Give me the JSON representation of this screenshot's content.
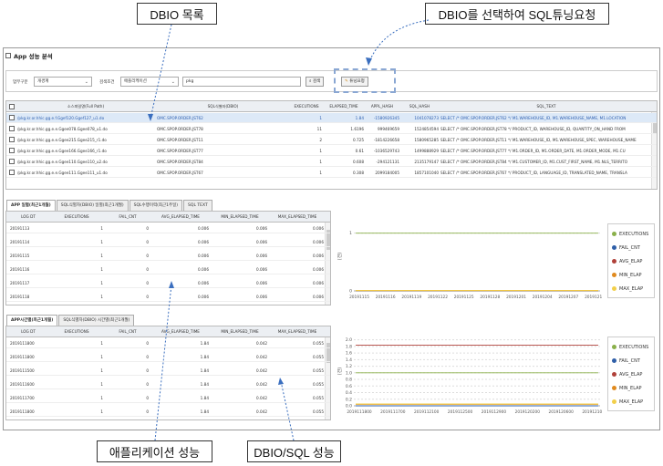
{
  "callouts": {
    "dbio_list": "DBIO 목록",
    "select_sql_tuning": "DBIO를 선택하여 SQL튜닝요청",
    "app_perf": "애플리케이션 성능",
    "dbio_sql_perf": "DBIO/SQL 성능"
  },
  "app": {
    "title": "App 성능 분석"
  },
  "search": {
    "task_label": "업무구분",
    "task_value": "개경계",
    "cond_label": "검색조건",
    "cond_value": "애플리케이션",
    "keyword": "pkg",
    "search_btn": "검색",
    "tuning_btn": "튜닝요청"
  },
  "dbio_grid": {
    "headers": [
      "소스파일명(Full Path)",
      "SQL식별자(DBIO)",
      "EXECUTIONS",
      "ELAPSED_TIME",
      "APPL_HASH",
      "SQL_HASH",
      "SQL_TEXT"
    ],
    "rows": [
      {
        "path": "/pkg.kr.or.hhic.gg.e.f.Ggef120.Ggef127_u1.do",
        "dbio": "OMC.SPOP.ORDER.JST62",
        "exec": "1",
        "elapsed": "1.84",
        "appl_hash": "-1580926345",
        "sql_hash": "1041078273",
        "sql_text": "SELECT /* OMC.SPOP.ORDER.JST62 */ M1.WAREHOUSE_ID, M1.WAREHOUSE_NAME, M1.LOCATION"
      },
      {
        "path": "/pkg.kr.or.hhic.gg.e.e.Ggee078.Ggee078_u1.do",
        "dbio": "OMC.SPOP.ORDER.JST78",
        "exec": "11",
        "elapsed": "1.6196",
        "appl_hash": "999469659",
        "sql_hash": "1524854594",
        "sql_text": "SELECT /* OMC.SPOP.ORDER.JST78 */ PRODUCT_ID, WAREHOUSE_ID, QUANTITY_ON_HAND FROM"
      },
      {
        "path": "/pkg.kr.or.hhic.gg.e.e.Ggee215.Ggee215_r1.do",
        "dbio": "OMC.SPOP.ORDER.JST11",
        "exec": "2",
        "elapsed": "0.725",
        "appl_hash": "-1814226658",
        "sql_hash": "1580965285",
        "sql_text": "SELECT /* OMC.SPOP.ORDER.JST11 */ M1.WAREHOUSE_ID, M1.WAREHOUSE_SPEC, WAREHOUSE_NAME"
      },
      {
        "path": "/pkg.kr.or.hhic.gg.e.e.Ggee166.Ggee166_r1.do",
        "dbio": "OMC.SPOP.ORDER.JST77",
        "exec": "1",
        "elapsed": "0.61",
        "appl_hash": "-1036529743",
        "sql_hash": "1499888929",
        "sql_text": "SELECT /* OMC.SPOP.ORDER.JST77 */ M1.ORDER_ID, M1.ORDER_DATE, M1.ORDER_MODE, M1.CU"
      },
      {
        "path": "/pkg.kr.or.hhic.gg.e.e.Ggee110.Ggee110_u2.do",
        "dbio": "OMC.SPOP.ORDER.JST84",
        "exec": "1",
        "elapsed": "0.608",
        "appl_hash": "-294121131",
        "sql_hash": "2135179147",
        "sql_text": "SELECT /* OMC.SPOP.ORDER.JST84 */ M1.CUSTOMER_ID, M1.CUST_FIRST_NAME, M1.NLS_TERRITO"
      },
      {
        "path": "/pkg.kr.or.hhic.gg.e.e.Ggee111.Ggee111_u1.do",
        "dbio": "OMC.SPOP.ORDER.JST67",
        "exec": "1",
        "elapsed": "0.308",
        "appl_hash": "2099184005",
        "sql_hash": "1857101040",
        "sql_text": "SELECT /* OMC.SPOP.ORDER.JST67 */ PRODUCT_ID, LANGUAGE_ID, TRANSLATED_NAME, TRANSLA"
      }
    ]
  },
  "tabs1": [
    "APP 일별(최근1개월)",
    "SQL식별자(DBIO) 일별(최근1개월)",
    "SQL수행이력(최근1주일)",
    "SQL TEXT"
  ],
  "daily_grid": {
    "headers": [
      "LOG DT",
      "EXECUTIONS",
      "FAIL_CNT",
      "AVG_ELAPSED_TIME",
      "MIN_ELAPSED_TIME",
      "MAX_ELAPSED_TIME"
    ],
    "rows": [
      [
        "20191113",
        "1",
        "0",
        "0.006",
        "0.006",
        "0.006"
      ],
      [
        "20191114",
        "1",
        "0",
        "0.006",
        "0.006",
        "0.006"
      ],
      [
        "20191115",
        "1",
        "0",
        "0.006",
        "0.006",
        "0.006"
      ],
      [
        "20191116",
        "1",
        "0",
        "0.006",
        "0.006",
        "0.006"
      ],
      [
        "20191117",
        "1",
        "0",
        "0.006",
        "0.006",
        "0.006"
      ],
      [
        "20191118",
        "1",
        "0",
        "0.006",
        "0.006",
        "0.006"
      ]
    ]
  },
  "tabs2": [
    "APP시간별(최근1개월)",
    "SQL식별자(DBIO) 시간별(최근1개월)"
  ],
  "hourly_grid": {
    "headers": [
      "LOG DT",
      "EXECUTIONS",
      "FAIL_CNT",
      "AVG_ELAPSED_TIME",
      "MIN_ELAPSED_TIME",
      "MAX_ELAPSED_TIME"
    ],
    "rows": [
      [
        "2019111800",
        "1",
        "0",
        "1.84",
        "0.042",
        "0.055"
      ],
      [
        "2019111800",
        "1",
        "0",
        "1.84",
        "0.042",
        "0.055"
      ],
      [
        "2019111500",
        "1",
        "0",
        "1.84",
        "0.042",
        "0.055"
      ],
      [
        "2019111600",
        "1",
        "0",
        "1.84",
        "0.042",
        "0.055"
      ],
      [
        "2019111700",
        "1",
        "0",
        "1.84",
        "0.042",
        "0.055"
      ],
      [
        "2019111800",
        "1",
        "0",
        "1.84",
        "0.042",
        "0.055"
      ]
    ]
  },
  "legend": [
    {
      "name": "EXECUTIONS",
      "color": "#8ab04a"
    },
    {
      "name": "FAIL_CNT",
      "color": "#2f5fa8"
    },
    {
      "name": "AVG_ELAP",
      "color": "#b0413a"
    },
    {
      "name": "MIN_ELAP",
      "color": "#e08a1e"
    },
    {
      "name": "MAX_ELAP",
      "color": "#f2cf4a"
    }
  ],
  "chart_data": [
    {
      "type": "line",
      "ylabel": "(건)",
      "x": [
        "20191115",
        "20191116",
        "20191119",
        "20191122",
        "20191125",
        "20191128",
        "20191201",
        "20191204",
        "20191207",
        "20191210"
      ],
      "y_ticks": [
        "0",
        "1"
      ],
      "ylim": [
        0,
        1.2
      ],
      "series": [
        {
          "name": "EXECUTIONS",
          "values": [
            1,
            1,
            1,
            1,
            1,
            1,
            1,
            1,
            1,
            1
          ]
        },
        {
          "name": "FAIL_CNT",
          "values": [
            0,
            0,
            0,
            0,
            0,
            0,
            0,
            0,
            0,
            0
          ]
        },
        {
          "name": "AVG_ELAP",
          "values": [
            0.006,
            0.006,
            0.006,
            0.006,
            0.006,
            0.006,
            0.006,
            0.006,
            0.006,
            0.006
          ]
        },
        {
          "name": "MIN_ELAP",
          "values": [
            0.006,
            0.006,
            0.006,
            0.006,
            0.006,
            0.006,
            0.006,
            0.006,
            0.006,
            0.006
          ]
        },
        {
          "name": "MAX_ELAP",
          "values": [
            0.006,
            0.006,
            0.006,
            0.006,
            0.006,
            0.006,
            0.006,
            0.006,
            0.006,
            0.006
          ]
        }
      ]
    },
    {
      "type": "line",
      "ylabel": "(건)",
      "x": [
        "2019111800",
        "2019111700",
        "2019112100",
        "2019112500",
        "2019112900",
        "2019120200",
        "2019120600",
        "2019121000"
      ],
      "y_ticks": [
        "0.0",
        "0.2",
        "0.4",
        "0.6",
        "0.8",
        "1.0",
        "1.2",
        "1.4",
        "1.6",
        "1.8",
        "2.0"
      ],
      "ylim": [
        0,
        2.1
      ],
      "series": [
        {
          "name": "EXECUTIONS",
          "values": [
            1,
            1,
            1,
            1,
            1,
            1,
            1,
            1
          ]
        },
        {
          "name": "FAIL_CNT",
          "values": [
            0,
            0,
            0,
            0,
            0,
            0,
            0,
            0
          ]
        },
        {
          "name": "AVG_ELAP",
          "values": [
            1.84,
            1.84,
            1.84,
            1.84,
            1.84,
            1.84,
            1.84,
            1.84
          ]
        },
        {
          "name": "MIN_ELAP",
          "values": [
            0.042,
            0.042,
            0.042,
            0.042,
            0.042,
            0.042,
            0.042,
            0.042
          ]
        },
        {
          "name": "MAX_ELAP",
          "values": [
            0.055,
            0.055,
            0.055,
            0.055,
            0.055,
            0.055,
            0.055,
            0.055
          ]
        }
      ]
    }
  ]
}
